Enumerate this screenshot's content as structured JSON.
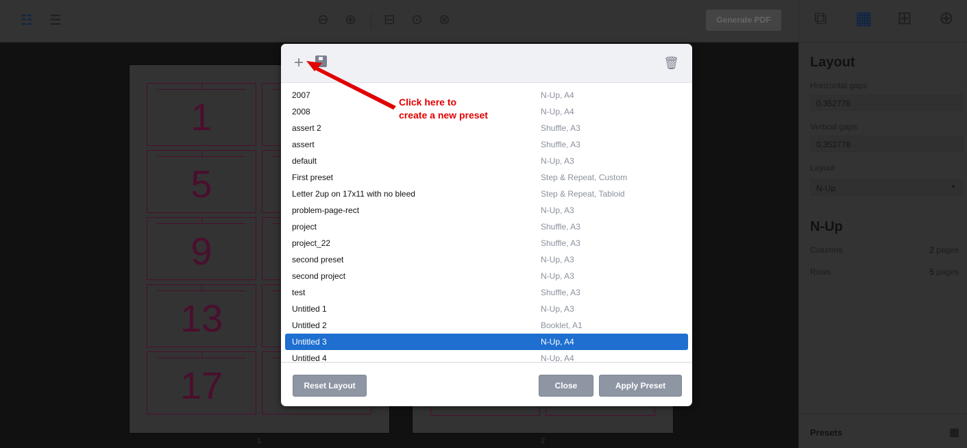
{
  "toolbar": {
    "generate_label": "Generate PDF",
    "icons": [
      "two-column-view-icon",
      "single-column-view-icon",
      "zoom-out-icon",
      "zoom-in-icon",
      "fit-width-icon",
      "zoom-reset-icon",
      "zoom-fit-icon"
    ]
  },
  "canvas": {
    "pages": [
      {
        "label": "1",
        "cells": [
          "1",
          "5",
          "9",
          "13",
          "17"
        ]
      },
      {
        "label": "2"
      }
    ]
  },
  "sidebar": {
    "tabs": [
      "pages-icon",
      "layout-icon",
      "margins-icon",
      "marks-icon"
    ],
    "active_tab": "layout-icon",
    "layout_title": "Layout",
    "horizontal_gaps_label": "Horizontal gaps",
    "horizontal_gaps_value": "0.352778",
    "vertical_gaps_label": "Vertical gaps",
    "vertical_gaps_value": "0.352778",
    "layout_label": "Layout",
    "layout_value": "N-Up",
    "nup_title": "N-Up",
    "columns_label": "Columns",
    "columns_value": "2",
    "columns_unit": "pages",
    "rows_label": "Rows",
    "rows_value": "5",
    "rows_unit": "pages",
    "presets_label": "Presets"
  },
  "modal": {
    "presets": [
      {
        "name": "2007",
        "desc": "N-Up, A4"
      },
      {
        "name": "2008",
        "desc": "N-Up, A4"
      },
      {
        "name": "assert 2",
        "desc": "Shuffle, A3"
      },
      {
        "name": "assert",
        "desc": "Shuffle, A3"
      },
      {
        "name": "default",
        "desc": "N-Up, A3"
      },
      {
        "name": "First preset",
        "desc": "Step & Repeat, Custom"
      },
      {
        "name": "Letter 2up on 17x11 with no bleed",
        "desc": "Step & Repeat, Tabloid"
      },
      {
        "name": "problem-page-rect",
        "desc": "N-Up, A3"
      },
      {
        "name": "project",
        "desc": "Shuffle, A3"
      },
      {
        "name": "project_22",
        "desc": "Shuffle, A3"
      },
      {
        "name": "second preset",
        "desc": "N-Up, A3"
      },
      {
        "name": "second project",
        "desc": "N-Up, A3"
      },
      {
        "name": "test",
        "desc": "Shuffle, A3"
      },
      {
        "name": "Untitled 1",
        "desc": "N-Up, A3"
      },
      {
        "name": "Untitled 2",
        "desc": "Booklet, A1"
      },
      {
        "name": "Untitled 3",
        "desc": "N-Up, A4"
      },
      {
        "name": "Untitled 4",
        "desc": "N-Up, A4"
      }
    ],
    "selected": "Untitled 3",
    "reset_label": "Reset Layout",
    "close_label": "Close",
    "apply_label": "Apply Preset"
  },
  "annotation": {
    "line1": "Click here to",
    "line2": "create a new preset",
    "color": "#e00000"
  },
  "colors": {
    "selected": "#1e6fd0",
    "button": "#8e95a3"
  }
}
